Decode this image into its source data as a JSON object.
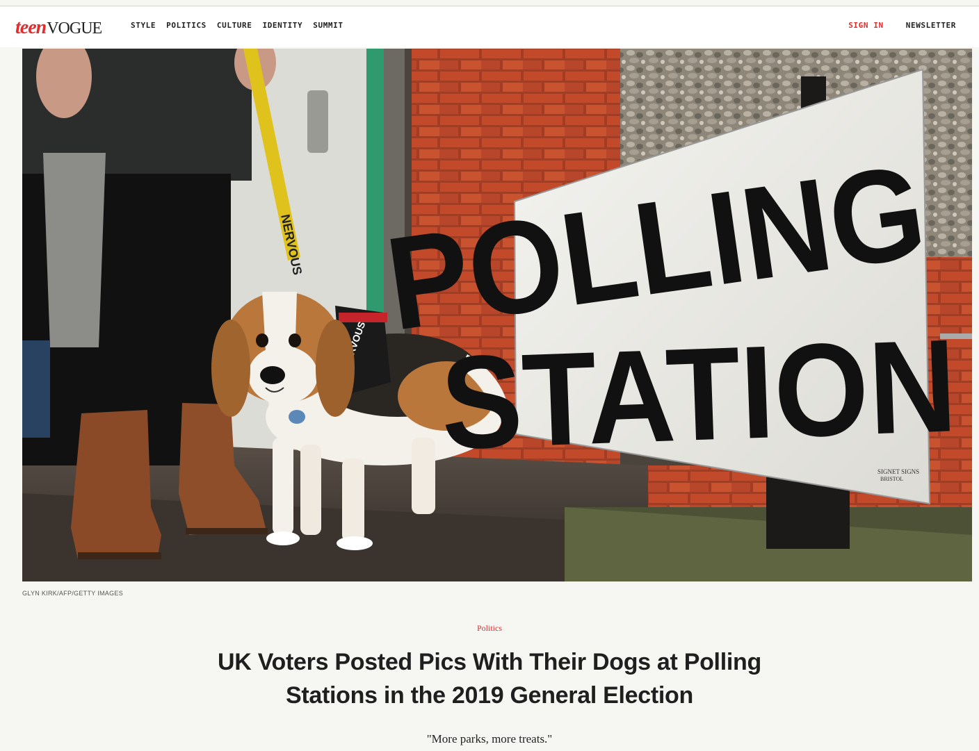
{
  "brand": {
    "logo_primary": "teen",
    "logo_secondary": "VOGUE",
    "accent_color": "#e12d2d"
  },
  "nav": {
    "items": [
      "STYLE",
      "POLITICS",
      "CULTURE",
      "IDENTITY",
      "SUMMIT"
    ],
    "sign_in": "SIGN IN",
    "newsletter": "NEWSLETTER"
  },
  "hero": {
    "sign_line1": "POLLING",
    "sign_line2": "STATION",
    "sign_maker_line1": "SIGNET SIGNS",
    "sign_maker_line2": "BRISTOL",
    "leash_text": "NERVOUS",
    "harness_text": "NERVOUS"
  },
  "article": {
    "photo_credit": "GLYN KIRK/AFP/GETTY IMAGES",
    "rubric": "Politics",
    "headline_line1": "UK Voters Posted Pics With Their Dogs at Polling",
    "headline_line2": "Stations in the 2019 General Election",
    "dek": "\"More parks, more treats.\""
  }
}
